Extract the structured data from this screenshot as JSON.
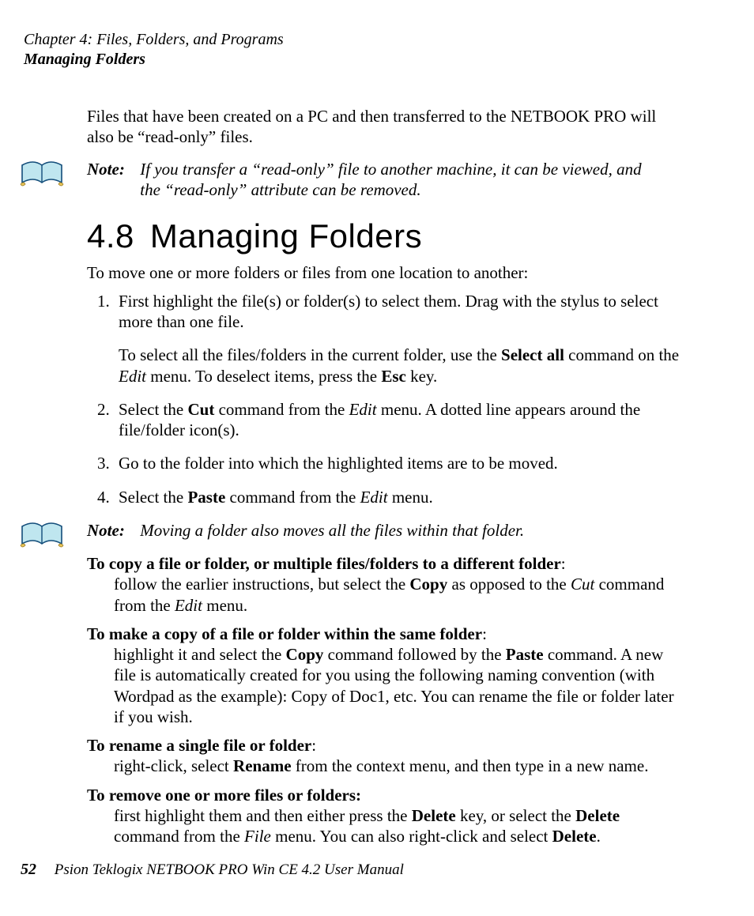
{
  "header": {
    "chapter": "Chapter 4:  Files, Folders, and Programs",
    "section": "Managing Folders"
  },
  "intro_para": "Files that have been created on a PC and then transferred to the NETBOOK PRO will also be “read-only” files.",
  "note1": {
    "label": "Note:",
    "text": "If you transfer a “read-only” file to another machine, it can be viewed, and the “read-only” attribute can be removed."
  },
  "heading": {
    "num": "4.8",
    "title": "Managing Folders"
  },
  "lead_in": "To move one or more folders or files from one location to another:",
  "steps": {
    "s1a": "First highlight the file(s) or folder(s) to select them. Drag with the stylus to select more than one file.",
    "s1b_pre": "To select all the files/folders in the current folder, use the ",
    "s1b_bold1": "Select all",
    "s1b_mid1": " command on the ",
    "s1b_ital1": "Edit",
    "s1b_mid2": " menu. To deselect items, press the ",
    "s1b_bold2": "Esc",
    "s1b_post": " key.",
    "s2_pre": "Select the ",
    "s2_bold1": "Cut",
    "s2_mid1": " command from the ",
    "s2_ital1": "Edit",
    "s2_post": " menu. A dotted line appears around the file/folder icon(s).",
    "s3": "Go to the folder into which the highlighted items are to be moved.",
    "s4_pre": "Select the ",
    "s4_bold1": "Paste",
    "s4_mid1": " command from the ",
    "s4_ital1": "Edit",
    "s4_post": " menu."
  },
  "note2": {
    "label": "Note:",
    "text": "Moving a folder also moves all the files within that folder."
  },
  "defs": {
    "d1_lead": "To copy a file or folder, or multiple files/folders to a different folder",
    "d1_colon": ":",
    "d1_body_pre": "follow the earlier instructions, but select the ",
    "d1_bold1": "Copy",
    "d1_mid1": " as opposed to the ",
    "d1_ital1": "Cut",
    "d1_mid2": " command from the ",
    "d1_ital2": "Edit",
    "d1_post": " menu.",
    "d2_lead": "To make a copy of a file or folder within the same folder",
    "d2_colon": ":",
    "d2_body_pre": "highlight it and select the ",
    "d2_bold1": "Copy",
    "d2_mid1": " command followed by the ",
    "d2_bold2": "Paste",
    "d2_post": " command. A new file is automatically created for you using the following naming convention (with Wordpad as the example): Copy of Doc1, etc. You can rename the file or folder later if you wish.",
    "d3_lead": "To rename a single file or folder",
    "d3_colon": ":",
    "d3_body_pre": "right-click, select ",
    "d3_bold1": "Rename",
    "d3_post": " from the context menu, and then type in a new name.",
    "d4_lead": "To remove one or more files or folders:",
    "d4_body_pre": "first highlight them and then either press the ",
    "d4_bold1": "Delete",
    "d4_mid1": " key, or select the ",
    "d4_bold2": "Delete",
    "d4_mid2": " command from the ",
    "d4_ital1": "File",
    "d4_mid3": " menu. You can also right-click and select ",
    "d4_bold3": "Delete",
    "d4_post": "."
  },
  "footer": {
    "page": "52",
    "title": "Psion Teklogix NETBOOK PRO Win CE 4.2 User Manual"
  },
  "icons": {
    "book": "book-icon"
  },
  "colors": {
    "book_fill": "#bfe6ef",
    "book_stroke": "#134d7a",
    "book_accent": "#e9c55a"
  }
}
